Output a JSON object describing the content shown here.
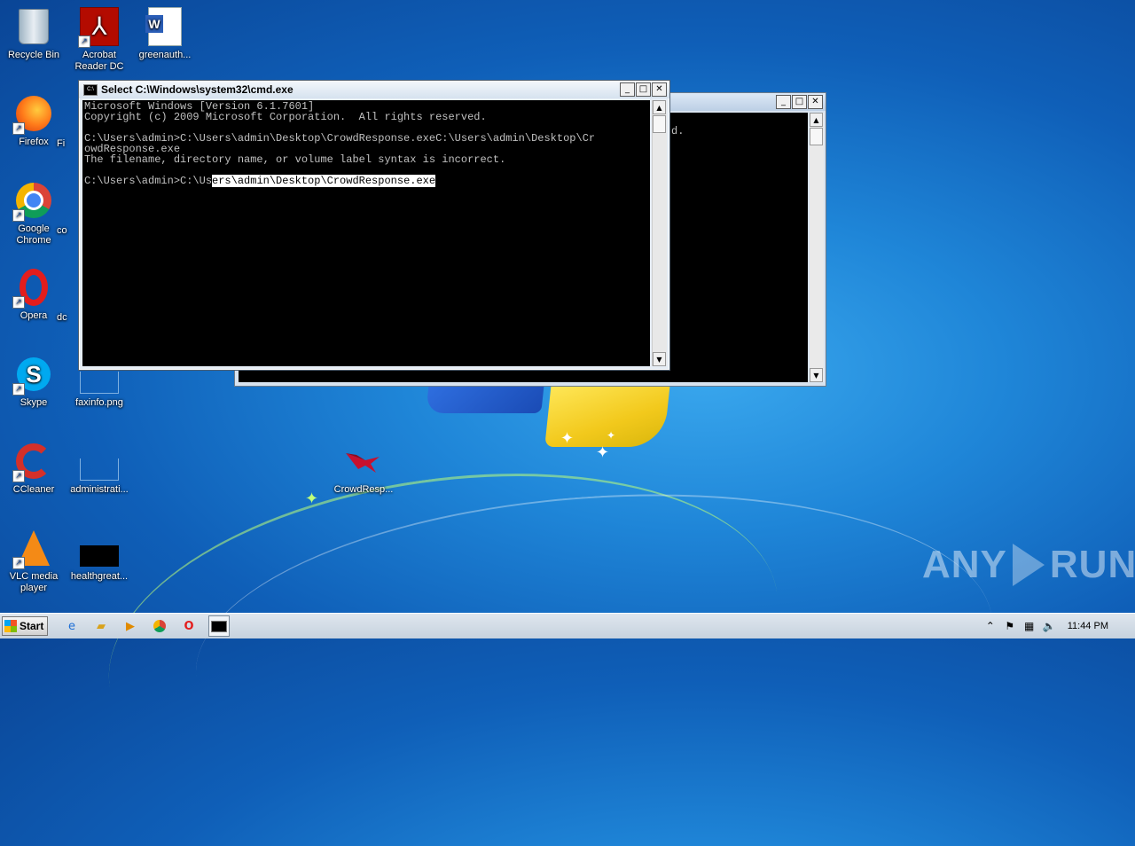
{
  "desktop": {
    "icons": [
      {
        "label": "Recycle Bin"
      },
      {
        "label": "Acrobat Reader DC"
      },
      {
        "label": "greenauth..."
      },
      {
        "label": "Firefox"
      },
      {
        "label": "Google Chrome"
      },
      {
        "label": "Opera"
      },
      {
        "label": "Skype"
      },
      {
        "label": "CCleaner"
      },
      {
        "label": "VLC media player"
      },
      {
        "label": "faxinfo.png"
      },
      {
        "label": "administrati..."
      },
      {
        "label": "healthgreat..."
      },
      {
        "label": "CrowdResp..."
      },
      {
        "label": "Fi"
      },
      {
        "label": "co"
      },
      {
        "label": "dc"
      }
    ]
  },
  "background_window": {
    "partial_text": "d."
  },
  "cmd_window": {
    "title": "Select C:\\Windows\\system32\\cmd.exe",
    "lines": [
      "Microsoft Windows [Version 6.1.7601]",
      "Copyright (c) 2009 Microsoft Corporation.  All rights reserved.",
      "",
      "C:\\Users\\admin>C:\\Users\\admin\\Desktop\\CrowdResponse.exeC:\\Users\\admin\\Desktop\\Cr",
      "owdResponse.exe",
      "The filename, directory name, or volume label syntax is incorrect.",
      ""
    ],
    "prompt_unselected": "C:\\Users\\admin>C:\\Us",
    "prompt_selected": "ers\\admin\\Desktop\\CrowdResponse.exe"
  },
  "watermark": {
    "left": "ANY",
    "right": "RUN"
  },
  "taskbar": {
    "start_label": "Start",
    "clock": "11:44 PM"
  }
}
